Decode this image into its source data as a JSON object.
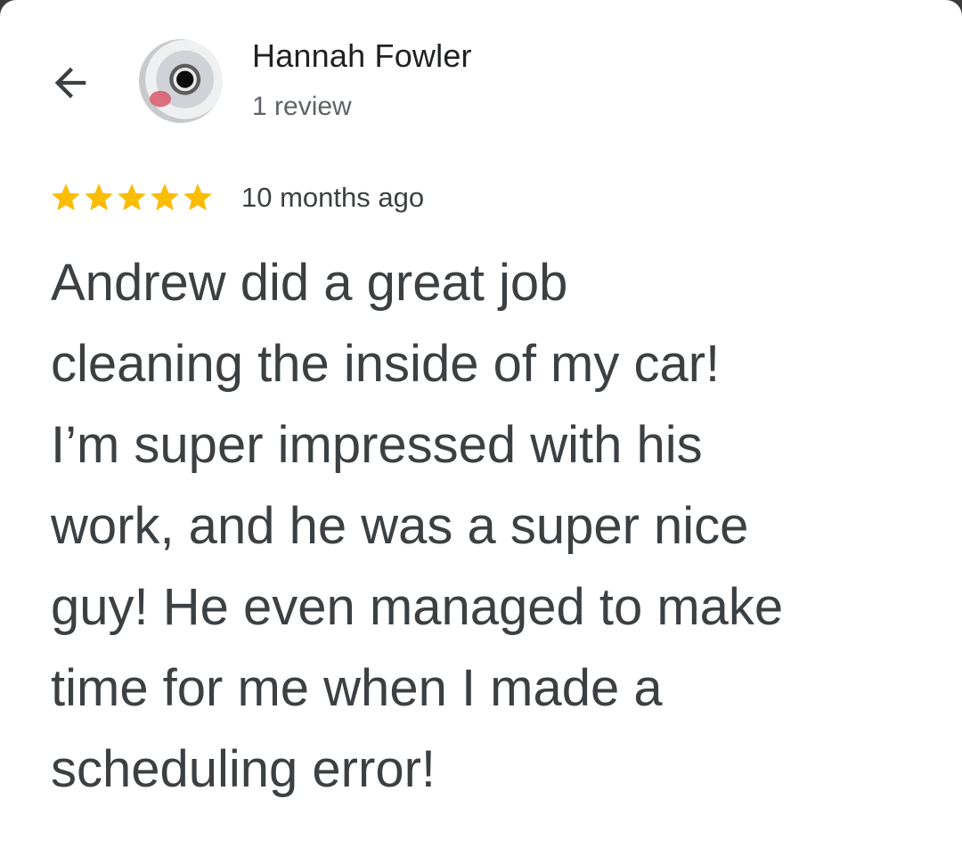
{
  "reviewer": {
    "name": "Hannah Fowler",
    "review_count": "1 review",
    "avatar_icon": "profile-photo"
  },
  "navigation": {
    "back_icon": "arrow-left-icon"
  },
  "review": {
    "rating": 5,
    "max_rating": 5,
    "star_color": "#fbbc04",
    "time_ago": "10 months ago",
    "text": "Andrew did a great job\ncleaning the inside of my car!\nI’m super impressed with his\nwork, and he was a super nice\nguy! He even managed to make\ntime for me when I made a\nscheduling error!"
  }
}
